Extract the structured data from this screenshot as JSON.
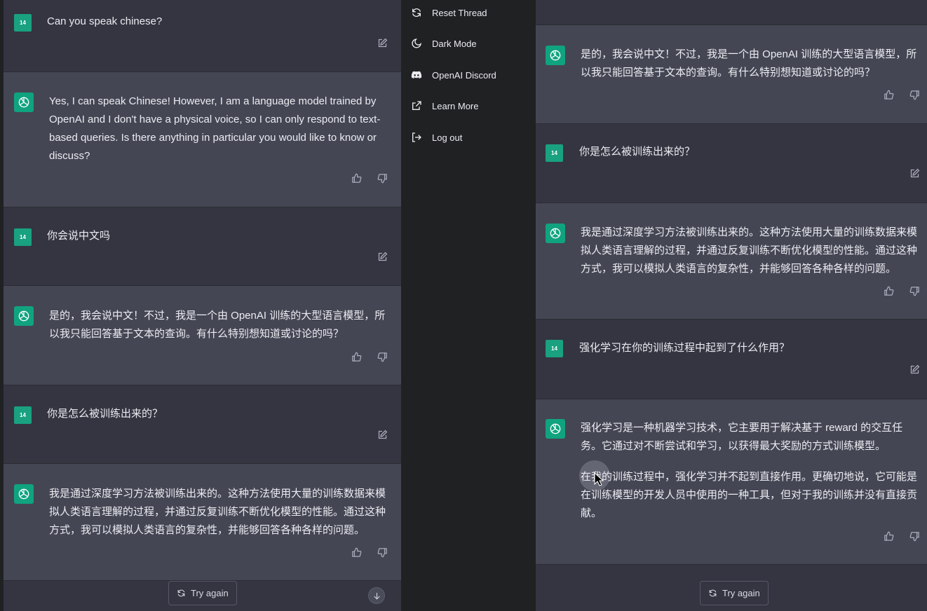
{
  "left": {
    "messages": [
      {
        "role": "user",
        "avatar": "14",
        "text": "Can you speak chinese?"
      },
      {
        "role": "assistant",
        "text": "Yes, I can speak Chinese! However, I am a language model trained by OpenAI and I don't have a physical voice, so I can only respond to text-based queries. Is there anything in particular you would like to know or discuss?"
      },
      {
        "role": "user",
        "avatar": "14",
        "text": "你会说中文吗"
      },
      {
        "role": "assistant",
        "text": "是的，我会说中文！不过，我是一个由 OpenAI 训练的大型语言模型，所以我只能回答基于文本的查询。有什么特别想知道或讨论的吗？"
      },
      {
        "role": "user",
        "avatar": "14",
        "text": "你是怎么被训练出来的？"
      },
      {
        "role": "assistant",
        "text": "我是通过深度学习方法被训练出来的。这种方法使用大量的训练数据来模拟人类语言理解的过程，并通过反复训练不断优化模型的性能。通过这种方式，我可以模拟人类语言的复杂性，并能够回答各种各样的问题。"
      }
    ],
    "try_again_label": "Try again"
  },
  "menu": {
    "items": [
      {
        "label": "Reset Thread",
        "icon": "refresh-icon"
      },
      {
        "label": "Dark Mode",
        "icon": "moon-icon"
      },
      {
        "label": "OpenAI Discord",
        "icon": "discord-icon"
      },
      {
        "label": "Learn More",
        "icon": "external-link-icon"
      },
      {
        "label": "Log out",
        "icon": "logout-icon"
      }
    ]
  },
  "right": {
    "messages": [
      {
        "role": "assistant",
        "text": "是的，我会说中文！不过，我是一个由 OpenAI 训练的大型语言模型，所以我只能回答基于文本的查询。有什么特别想知道或讨论的吗？"
      },
      {
        "role": "user",
        "avatar": "14",
        "text": "你是怎么被训练出来的？"
      },
      {
        "role": "assistant",
        "text": "我是通过深度学习方法被训练出来的。这种方法使用大量的训练数据来模拟人类语言理解的过程，并通过反复训练不断优化模型的性能。通过这种方式，我可以模拟人类语言的复杂性，并能够回答各种各样的问题。"
      },
      {
        "role": "user",
        "avatar": "14",
        "text": "强化学习在你的训练过程中起到了什么作用？"
      },
      {
        "role": "assistant",
        "text": "强化学习是一种机器学习技术，它主要用于解决基于 reward 的交互任务。它通过对不断尝试和学习，以获得最大奖励的方式训练模型。",
        "text2": "在我的训练过程中，强化学习并不起到直接作用。更确切地说，它可能是在训练模型的开发人员中使用的一种工具，但对于我的训练并没有直接贡献。"
      }
    ],
    "try_again_label": "Try again"
  },
  "colors": {
    "accent": "#10a37f",
    "user_avatar": "#19a180",
    "bg_user": "#343541",
    "bg_bot": "#444654",
    "sidebar": "#202123"
  }
}
